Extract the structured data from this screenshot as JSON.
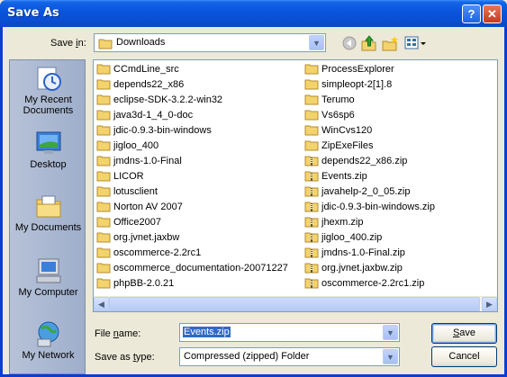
{
  "window": {
    "title": "Save As"
  },
  "titlebar": {
    "help_glyph": "?",
    "close_glyph": "✕"
  },
  "save_in": {
    "label_prefix": "Save ",
    "label_key": "i",
    "label_suffix": "n:",
    "value": "Downloads"
  },
  "toolbar": {
    "icons": [
      "back-icon",
      "up-folder-icon",
      "new-folder-icon",
      "views-menu-icon"
    ]
  },
  "places": [
    {
      "id": "recent",
      "label": "My Recent Documents"
    },
    {
      "id": "desktop",
      "label": "Desktop"
    },
    {
      "id": "documents",
      "label": "My Documents"
    },
    {
      "id": "computer",
      "label": "My Computer"
    },
    {
      "id": "network",
      "label": "My Network"
    }
  ],
  "files": {
    "column1": [
      {
        "name": "CCmdLine_src",
        "type": "folder"
      },
      {
        "name": "depends22_x86",
        "type": "folder"
      },
      {
        "name": "eclipse-SDK-3.2.2-win32",
        "type": "folder"
      },
      {
        "name": "java3d-1_4_0-doc",
        "type": "folder"
      },
      {
        "name": "jdic-0.9.3-bin-windows",
        "type": "folder"
      },
      {
        "name": "jigloo_400",
        "type": "folder"
      },
      {
        "name": "jmdns-1.0-Final",
        "type": "folder"
      },
      {
        "name": "LICOR",
        "type": "folder"
      },
      {
        "name": "lotusclient",
        "type": "folder"
      },
      {
        "name": "Norton AV 2007",
        "type": "folder"
      },
      {
        "name": "Office2007",
        "type": "folder"
      },
      {
        "name": "org.jvnet.jaxbw",
        "type": "folder"
      },
      {
        "name": "oscommerce-2.2rc1",
        "type": "folder"
      },
      {
        "name": "oscommerce_documentation-20071227",
        "type": "folder"
      },
      {
        "name": "phpBB-2.0.21",
        "type": "folder"
      }
    ],
    "column2": [
      {
        "name": "ProcessExplorer",
        "type": "folder"
      },
      {
        "name": "simpleopt-2[1].8",
        "type": "folder"
      },
      {
        "name": "Terumo",
        "type": "folder"
      },
      {
        "name": "Vs6sp6",
        "type": "folder"
      },
      {
        "name": "WinCvs120",
        "type": "folder"
      },
      {
        "name": "ZipExeFiles",
        "type": "folder"
      },
      {
        "name": "depends22_x86.zip",
        "type": "zip"
      },
      {
        "name": "Events.zip",
        "type": "zip"
      },
      {
        "name": "javahelp-2_0_05.zip",
        "type": "zip"
      },
      {
        "name": "jdic-0.9.3-bin-windows.zip",
        "type": "zip"
      },
      {
        "name": "jhexm.zip",
        "type": "zip"
      },
      {
        "name": "jigloo_400.zip",
        "type": "zip"
      },
      {
        "name": "jmdns-1.0-Final.zip",
        "type": "zip"
      },
      {
        "name": "org.jvnet.jaxbw.zip",
        "type": "zip"
      },
      {
        "name": "oscommerce-2.2rc1.zip",
        "type": "zip"
      }
    ]
  },
  "scrollbar": {
    "left_arrow": "◀",
    "right_arrow": "▶"
  },
  "file_name": {
    "label_prefix": "File ",
    "label_key": "n",
    "label_suffix": "ame:",
    "value": "Events.zip"
  },
  "save_as_type": {
    "label_prefix": "Save as ",
    "label_key": "t",
    "label_suffix": "ype:",
    "value": "Compressed (zipped) Folder"
  },
  "buttons": {
    "save_key": "S",
    "save_rest": "ave",
    "cancel": "Cancel"
  },
  "colors": {
    "title_bar": "#0a55dc",
    "selection": "#316ac5",
    "folder": "#f3d36e"
  }
}
